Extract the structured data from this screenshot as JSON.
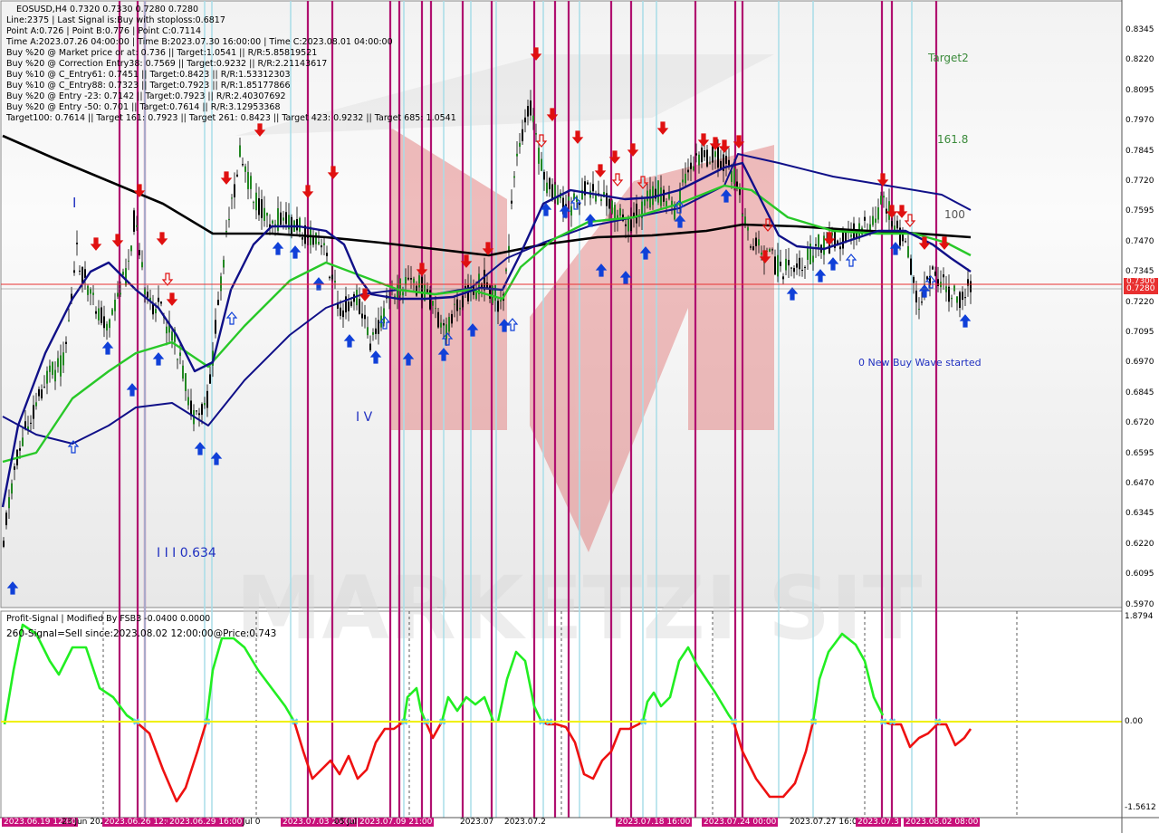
{
  "symbol_header": "EOSUSD,H4  0.7320 0.7330 0.7280 0.7280",
  "info_lines": [
    "Line:2375  | Last Signal is:Buy with stoploss:0.6817",
    "Point A:0.726  | Point B:0.776  | Point C:0.7114",
    "Time A:2023.07.26 04:00:00  | Time B:2023.07.30 16:00:00  | Time C:2023.08.01 04:00:00",
    "Buy %20 @ Market price or at: 0.736  || Target:1.0541  || R/R:5.85819521",
    "Buy %20 @ Correction Entry38: 0.7569  || Target:0.9232  || R/R:2.21143617",
    "Buy %10 @ C_Entry61: 0.7451  || Target:0.8423  || R/R:1.53312303",
    "Buy %10 @ C_Entry88: 0.7323  || Target:0.7923  || R/R:1.85177866",
    "Buy %20 @ Entry -23: 0.7142  || Target:0.7923  || R/R:2.40307692",
    "Buy %20 @ Entry -50: 0.701  || Target:0.7614  || R/R:3.12953368",
    "Target100: 0.7614  || Target 161: 0.7923  || Target 261: 0.8423  || Target 423: 0.9232  || Target 685: 1.0541"
  ],
  "wave_labels": {
    "w1": "I",
    "w3": "I I I 0.634",
    "w4": "I V"
  },
  "chart_annotations": {
    "target2": "Target2",
    "fib_1618": "161.8",
    "fib_100": "100",
    "new_wave": "0 New Buy Wave started"
  },
  "price_axis": {
    "ticks": [
      "0.8345",
      "0.8220",
      "0.8095",
      "0.7970",
      "0.7845",
      "0.7720",
      "0.7595",
      "0.7470",
      "0.7345",
      "0.7220",
      "0.7095",
      "0.6970",
      "0.6845",
      "0.6720",
      "0.6595",
      "0.6470",
      "0.6345",
      "0.6220",
      "0.6095",
      "0.5970"
    ],
    "current_price": "0.7280",
    "current_price_second": "0.7300"
  },
  "indicator": {
    "title": "Profit-Signal | Modified By FSB3 -0.0400 0.0000",
    "signal_text": "260-Signal=Sell since:2023.08.02 12:00:00@Price:0.743",
    "axis_top": "1.8794",
    "axis_zero": "0.00",
    "axis_bottom": "-1.5612"
  },
  "time_axis": [
    "2023.06.19 12:00",
    "23 Jun 2023",
    "2023.06.26 12:00",
    "2023.06.29 16:00",
    "Jul 0",
    "2023.07.03 20:00",
    "05 Jul 2023",
    "2023.07.09 21:00",
    "2023.07",
    "2023.07.2",
    "2023.07.18 16:00",
    "2023.07.24 00:00",
    "2023.07.27 16:00",
    "2023.07.3",
    "2023.08.02 08:00"
  ],
  "colors": {
    "magenta_line": "#b0106f",
    "cyan_line": "#a8dde8",
    "price_line": "#e83030",
    "ma_black": "#000000",
    "ma_navy": "#101088",
    "ma_green": "#28c828",
    "buy_arrow": "#1040d8",
    "sell_arrow": "#e01010",
    "osc_green": "#22ee22",
    "osc_red": "#ee1111",
    "zero_line": "#f0f000"
  }
}
